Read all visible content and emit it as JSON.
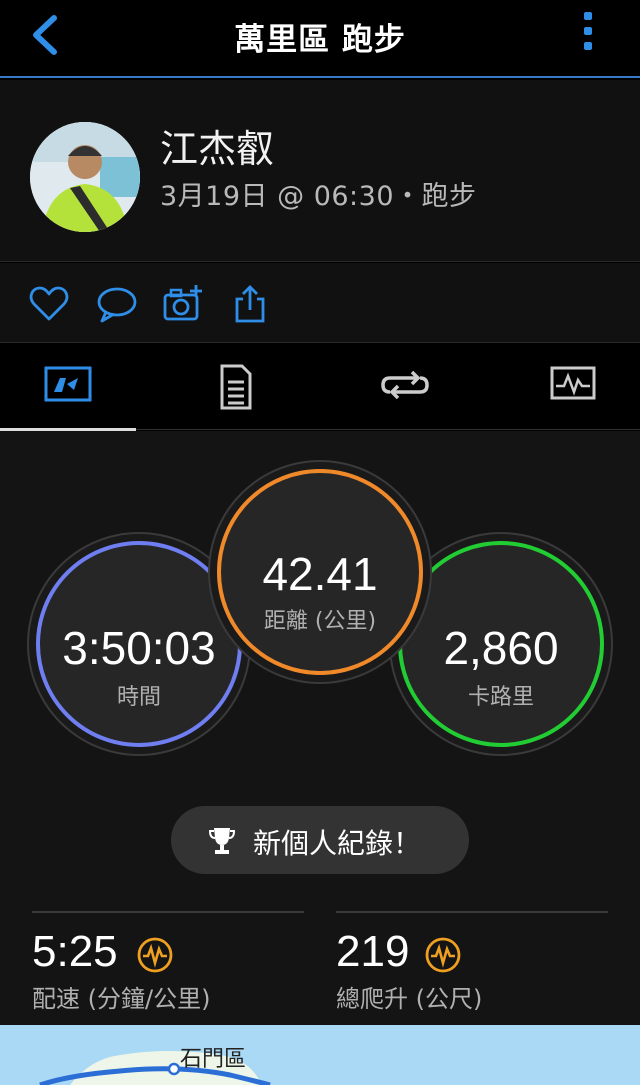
{
  "header": {
    "title": "萬里區 跑步"
  },
  "profile": {
    "name": "江杰叡",
    "meta": "3月19日 @ 06:30・跑步"
  },
  "actions": [
    "heart-icon",
    "comment-icon",
    "add-photo-icon",
    "share-icon"
  ],
  "tabs": [
    {
      "icon": "stats-tab-icon",
      "active": true
    },
    {
      "icon": "details-tab-icon",
      "active": false
    },
    {
      "icon": "laps-tab-icon",
      "active": false
    },
    {
      "icon": "charts-tab-icon",
      "active": false
    }
  ],
  "stats": {
    "distance": {
      "value": "42.41",
      "label": "距離 (公里)",
      "color": "#f0892a"
    },
    "time": {
      "value": "3:50:03",
      "label": "時間",
      "color": "#6f7ef0"
    },
    "calories": {
      "value": "2,860",
      "label": "卡路里",
      "color": "#22cc33"
    }
  },
  "record": {
    "label": "新個人紀錄！"
  },
  "metrics": {
    "pace": {
      "value": "5:25",
      "label": "配速 (分鐘/公里)"
    },
    "elevation": {
      "value": "219",
      "label": "總爬升 (公尺)"
    }
  },
  "map": {
    "place_label": "石門區"
  },
  "colors": {
    "accent": "#2f8ee8",
    "highlight": "#f0a020"
  }
}
